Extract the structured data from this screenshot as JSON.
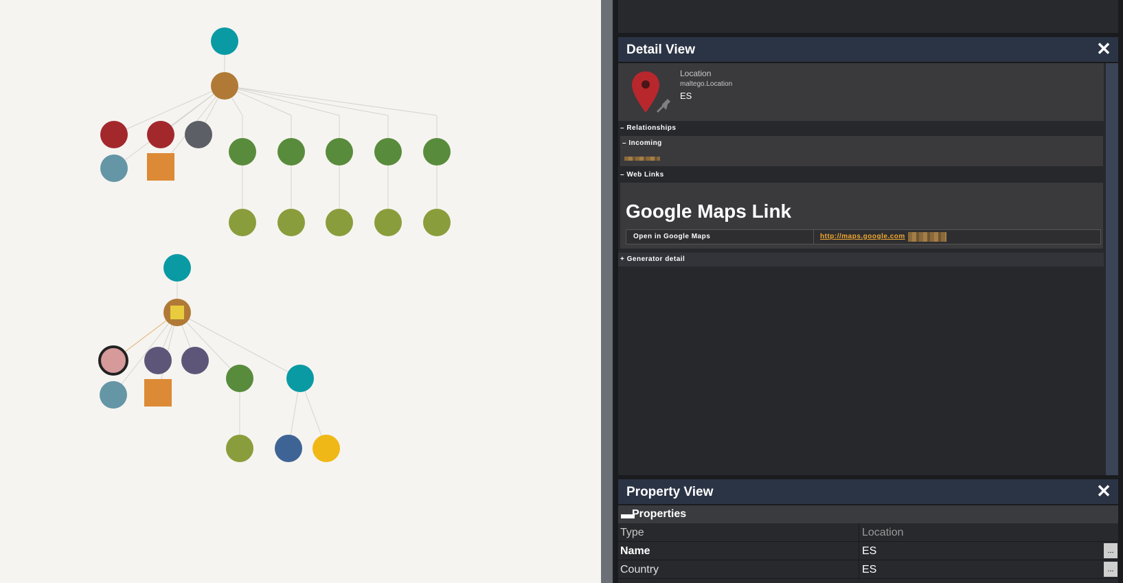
{
  "detail_view": {
    "title": "Detail View",
    "close_symbol": "✕",
    "entity": {
      "icon": "location-pin-icon",
      "type": "Location",
      "type_id": "maltego.Location",
      "value": "ES"
    },
    "sections": {
      "relationships": "– Relationships",
      "incoming": "– Incoming",
      "web_links": "– Web Links",
      "generator_detail": "+ Generator detail"
    },
    "web_link": {
      "heading": "Google Maps Link",
      "label": "Open in Google Maps",
      "url": "http://maps.google.com"
    }
  },
  "property_view": {
    "title": "Property View",
    "close_symbol": "✕",
    "section": "Properties",
    "rows": [
      {
        "key": "Type",
        "value": "Location",
        "bold": false,
        "dim": true
      },
      {
        "key": "Name",
        "value": "ES",
        "bold": true,
        "dim": false,
        "button": "..."
      },
      {
        "key": "Country",
        "value": "ES",
        "bold": false,
        "dim": false,
        "button": "..."
      }
    ]
  },
  "colors": {
    "teal": "#0a9aa4",
    "brown": "#b07a36",
    "red": "#a3282c",
    "slate": "#5c5f66",
    "steel_blue": "#6496a6",
    "orange": "#dc8a36",
    "green": "#588c3c",
    "olive": "#8a9d3c",
    "pink": "#d69a9a",
    "purple": "#5e5678",
    "navy": "#3e6496",
    "yellow": "#f0b816",
    "yellow_square": "#e8cc3e",
    "link_orange": "#f0a830"
  }
}
